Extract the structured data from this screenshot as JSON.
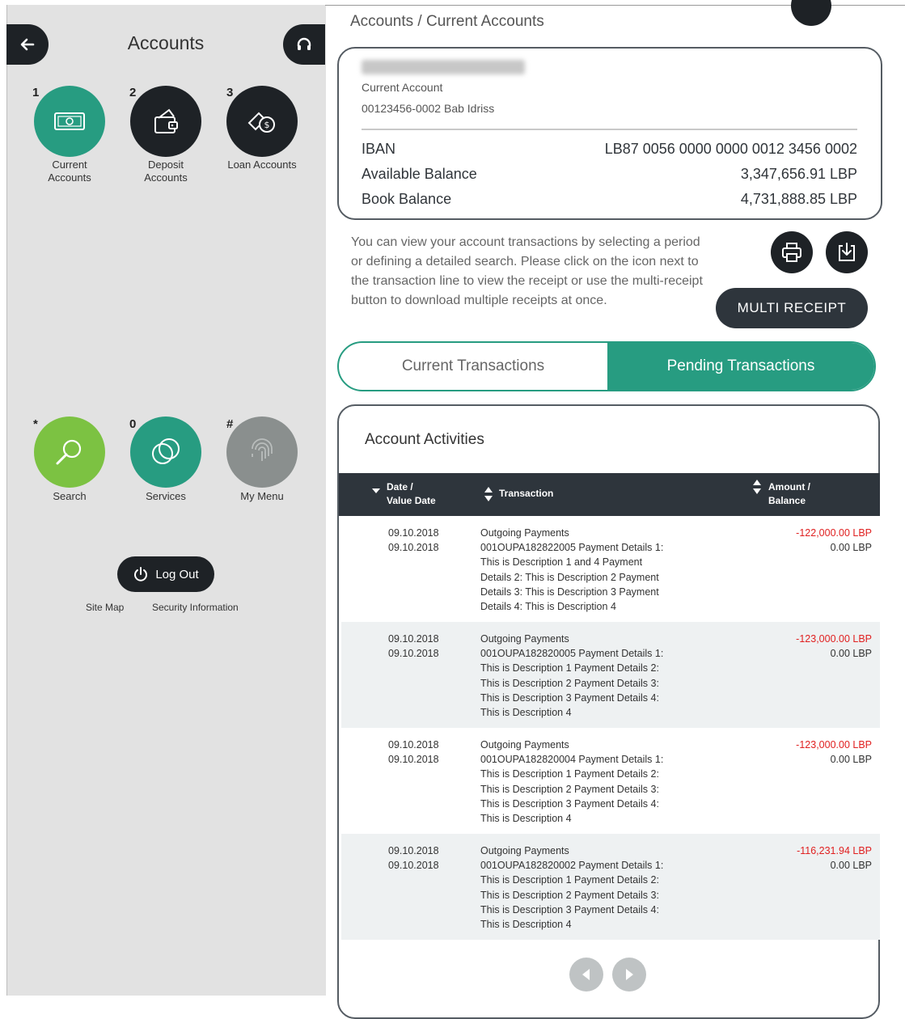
{
  "colors": {
    "teal": "#279c81",
    "green": "#7cc242",
    "dark": "#2e353c",
    "grey": "#8a8f8e",
    "red": "#e02020"
  },
  "left": {
    "title": "Accounts",
    "menu_top": [
      {
        "num": "1",
        "label": "Current\nAccounts",
        "icon": "cash-icon"
      },
      {
        "num": "2",
        "label": "Deposit\nAccounts",
        "icon": "wallet-icon"
      },
      {
        "num": "3",
        "label": "Loan Accounts",
        "icon": "loan-icon"
      }
    ],
    "menu_bottom": [
      {
        "num": "*",
        "label": "Search",
        "icon": "search-icon"
      },
      {
        "num": "0",
        "label": "Services",
        "icon": "services-icon"
      },
      {
        "num": "#",
        "label": "My Menu",
        "icon": "fingerprint-icon"
      }
    ],
    "logout": "Log Out",
    "links": {
      "sitemap": "Site Map",
      "security": "Security Information"
    }
  },
  "breadcrumb": "Accounts / Current Accounts",
  "account": {
    "type": "Current Account",
    "number": "00123456-0002 Bab Idriss",
    "rows": [
      {
        "label": "IBAN",
        "value": "LB87 0056 0000 0000 0012 3456 0002"
      },
      {
        "label": "Available Balance",
        "value": "3,347,656.91 LBP"
      },
      {
        "label": "Book Balance",
        "value": "4,731,888.85 LBP"
      }
    ]
  },
  "info_text": "You can view your account transactions by selecting a period or defining a detailed search. Please click on the icon next to the transaction line to view the receipt or use the multi-receipt button to download multiple receipts at once.",
  "multi_receipt": "MULTI RECEIPT",
  "tabs": {
    "current": "Current Transactions",
    "pending": "Pending Transactions"
  },
  "activities": {
    "title": "Account Activities",
    "columns": {
      "date": "Date /\nValue Date",
      "transaction": "Transaction",
      "amount": "Amount /\nBalance"
    },
    "rows": [
      {
        "date": "09.10.2018",
        "value_date": "09.10.2018",
        "description": "Outgoing Payments\n001OUPA182822005 Payment Details 1:\nThis is Description 1 and 4 Payment\nDetails 2: This is Description 2 Payment\nDetails 3: This is Description 3 Payment\nDetails 4: This is Description 4",
        "amount": "-122,000.00 LBP",
        "balance": "0.00 LBP"
      },
      {
        "date": "09.10.2018",
        "value_date": "09.10.2018",
        "description": "Outgoing Payments\n001OUPA182820005 Payment Details 1:\nThis is Description 1 Payment Details 2:\nThis is Description 2 Payment Details 3:\nThis is Description 3 Payment Details 4:\nThis is Description 4",
        "amount": "-123,000.00 LBP",
        "balance": "0.00 LBP"
      },
      {
        "date": "09.10.2018",
        "value_date": "09.10.2018",
        "description": "Outgoing Payments\n001OUPA182820004 Payment Details 1:\nThis is Description 1 Payment Details 2:\nThis is Description 2 Payment Details 3:\nThis is Description 3 Payment Details 4:\nThis is Description 4",
        "amount": "-123,000.00 LBP",
        "balance": "0.00 LBP"
      },
      {
        "date": "09.10.2018",
        "value_date": "09.10.2018",
        "description": "Outgoing Payments\n001OUPA182820002 Payment Details 1:\nThis is Description 1 Payment Details 2:\nThis is Description 2 Payment Details 3:\nThis is Description 3 Payment Details 4:\nThis is Description 4",
        "amount": "-116,231.94 LBP",
        "balance": "0.00 LBP"
      }
    ]
  }
}
